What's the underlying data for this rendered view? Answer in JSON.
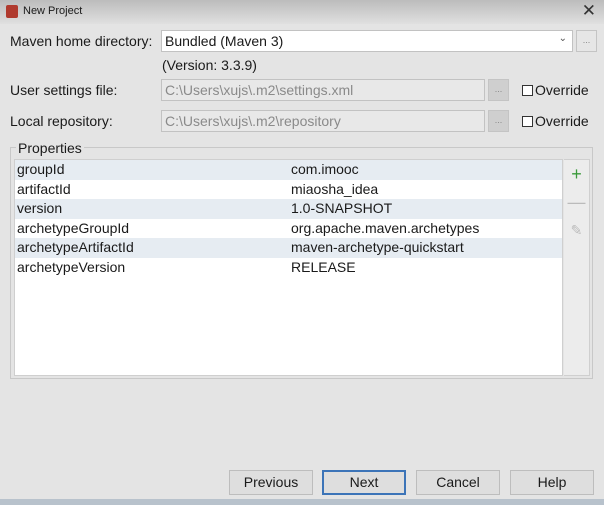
{
  "window": {
    "title": "New Project",
    "close": "✕"
  },
  "maven_home": {
    "label": "Maven home directory:",
    "value": "Bundled (Maven 3)",
    "version": "(Version: 3.3.9)"
  },
  "user_settings": {
    "label": "User settings file:",
    "value": "C:\\Users\\xujs\\.m2\\settings.xml",
    "override": "Override"
  },
  "local_repo": {
    "label": "Local repository:",
    "value": "C:\\Users\\xujs\\.m2\\repository",
    "override": "Override"
  },
  "browse": "...",
  "properties": {
    "label": "Properties",
    "rows": [
      {
        "key": "groupId",
        "value": "com.imooc"
      },
      {
        "key": "artifactId",
        "value": "miaosha_idea"
      },
      {
        "key": "version",
        "value": "1.0-SNAPSHOT"
      },
      {
        "key": "archetypeGroupId",
        "value": "org.apache.maven.archetypes"
      },
      {
        "key": "archetypeArtifactId",
        "value": "maven-archetype-quickstart"
      },
      {
        "key": "archetypeVersion",
        "value": "RELEASE"
      }
    ]
  },
  "buttons": {
    "previous": "Previous",
    "next": "Next",
    "cancel": "Cancel",
    "help": "Help"
  },
  "colors": {
    "add": "#3a9a3a",
    "accent": "#3c74b8"
  }
}
